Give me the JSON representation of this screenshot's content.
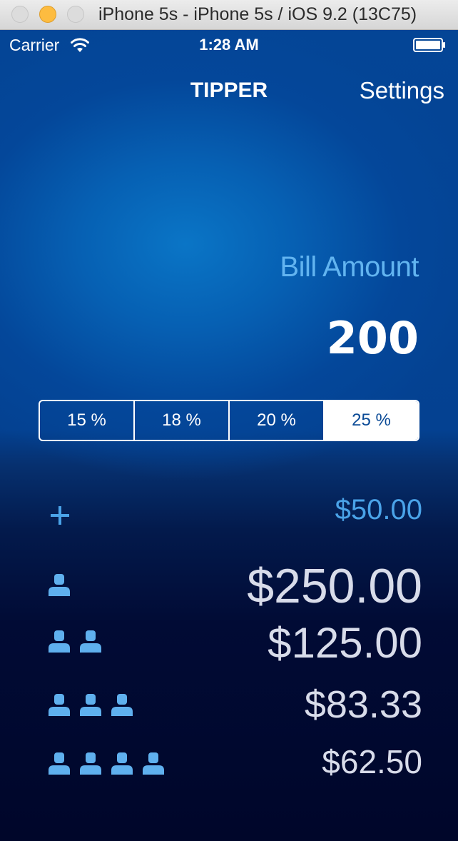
{
  "window": {
    "title": "iPhone 5s - iPhone 5s / iOS 9.2 (13C75)"
  },
  "status_bar": {
    "carrier": "Carrier",
    "time": "1:28 AM"
  },
  "nav": {
    "title": "TIPPER",
    "settings_label": "Settings"
  },
  "bill": {
    "label": "Bill Amount",
    "value": "200"
  },
  "tip_percent": {
    "options": [
      "15 %",
      "18 %",
      "20 %",
      "25 %"
    ],
    "selected": "25 %"
  },
  "tip": {
    "amount": "$50.00"
  },
  "totals": [
    {
      "people": 1,
      "amount": "$250.00"
    },
    {
      "people": 2,
      "amount": "$125.00"
    },
    {
      "people": 3,
      "amount": "$83.33"
    },
    {
      "people": 4,
      "amount": "$62.50"
    }
  ],
  "colors": {
    "background_top": "#044596",
    "background_bottom": "#00062a",
    "accent_light_blue": "#62b4f0",
    "tip_blue": "#4aa3e8",
    "total_text": "#d8dcea",
    "person_icon": "#5fb0ee"
  },
  "icons": {
    "plus": "plus-icon",
    "person": "person-icon",
    "wifi": "wifi-icon",
    "battery": "battery-icon"
  }
}
